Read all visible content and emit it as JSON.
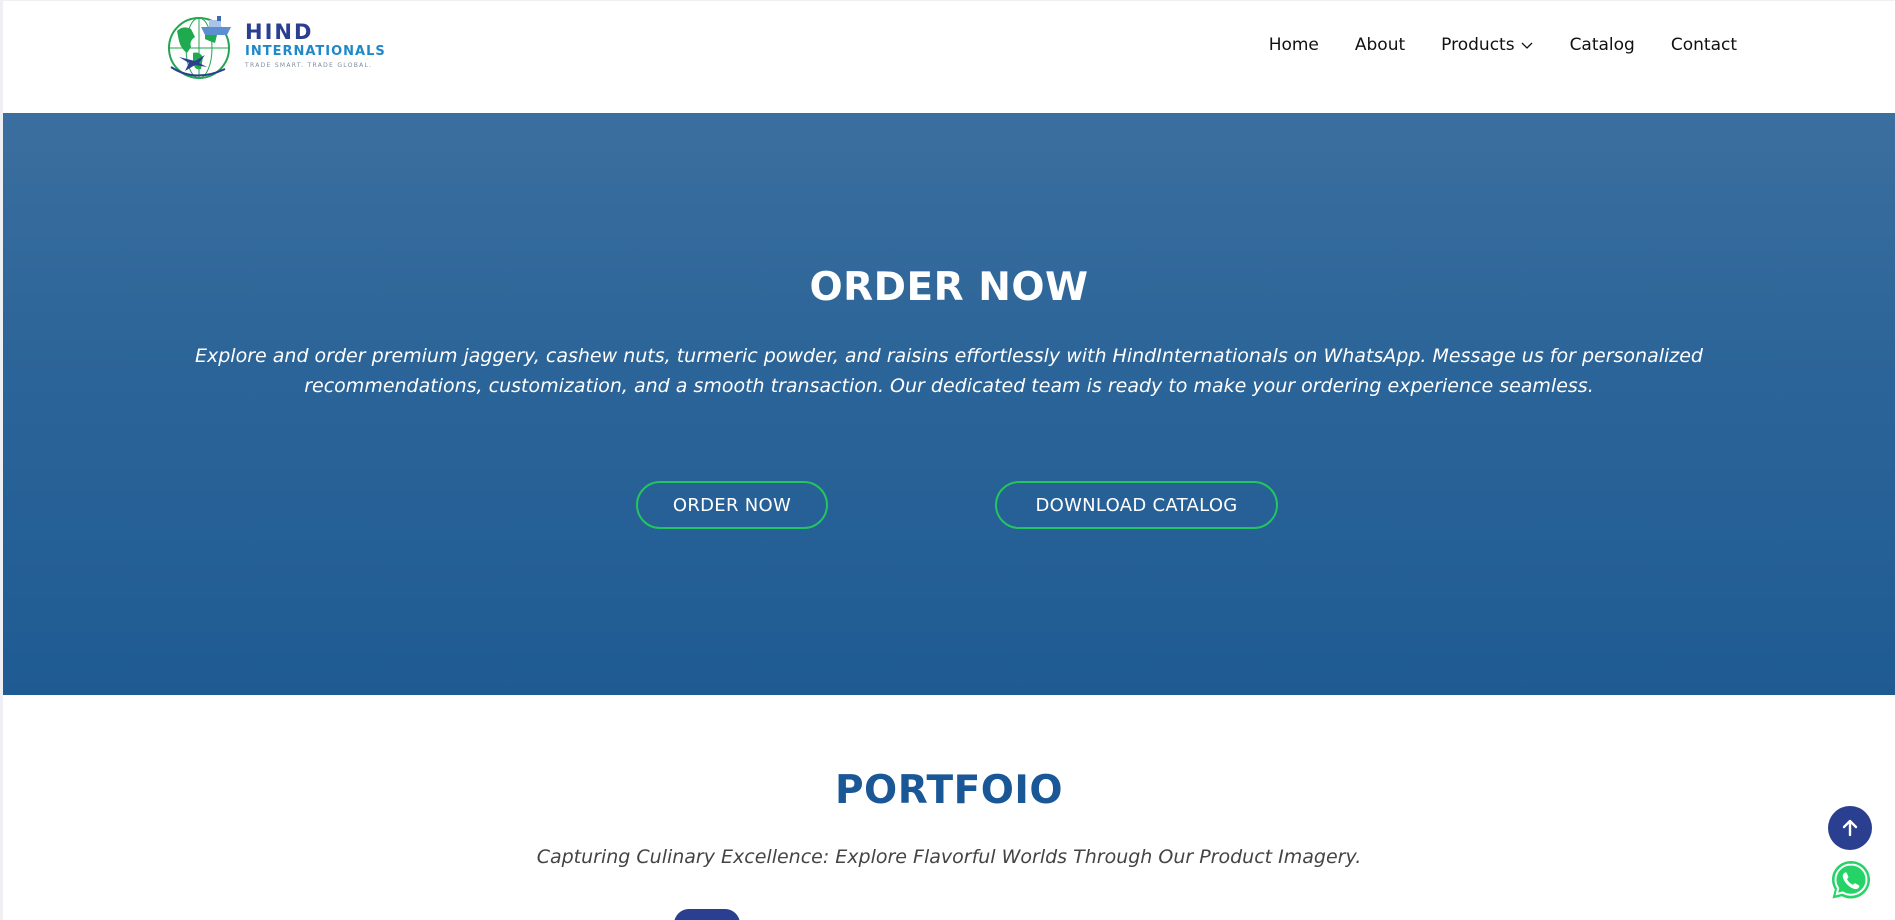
{
  "header": {
    "logo": {
      "brand_line1": "HIND",
      "brand_line2": "INTERNATIONALS",
      "tagline": "TRADE SMART. TRADE GLOBAL."
    },
    "nav": [
      {
        "label": "Home"
      },
      {
        "label": "About"
      },
      {
        "label": "Products",
        "has_dropdown": true
      },
      {
        "label": "Catalog"
      },
      {
        "label": "Contact"
      }
    ]
  },
  "hero": {
    "title": "ORDER NOW",
    "description": "Explore and order premium jaggery, cashew nuts, turmeric powder, and raisins effortlessly with HindInternationals on WhatsApp. Message us for personalized recommendations, customization, and a smooth transaction. Our dedicated team is ready to make your ordering experience seamless.",
    "buttons": {
      "order": "ORDER NOW",
      "catalog": "DOWNLOAD CATALOG"
    }
  },
  "portfolio": {
    "title": "PORTFOIO",
    "subtitle": "Capturing Culinary Excellence: Explore Flavorful Worlds Through Our Product Imagery."
  },
  "colors": {
    "brand_navy": "#2a3f8f",
    "brand_blue": "#1e88c8",
    "hero_bg_top": "#3b6f9f",
    "hero_bg_bottom": "#1f5b93",
    "button_border": "#22c55e",
    "portfolio_title": "#1a5796",
    "whatsapp_green": "#25d366"
  },
  "icons": {
    "logo": "globe-ship-plane-logo",
    "products_dropdown": "chevron-down-icon",
    "scroll_top": "arrow-up-icon",
    "whatsapp": "whatsapp-icon"
  }
}
